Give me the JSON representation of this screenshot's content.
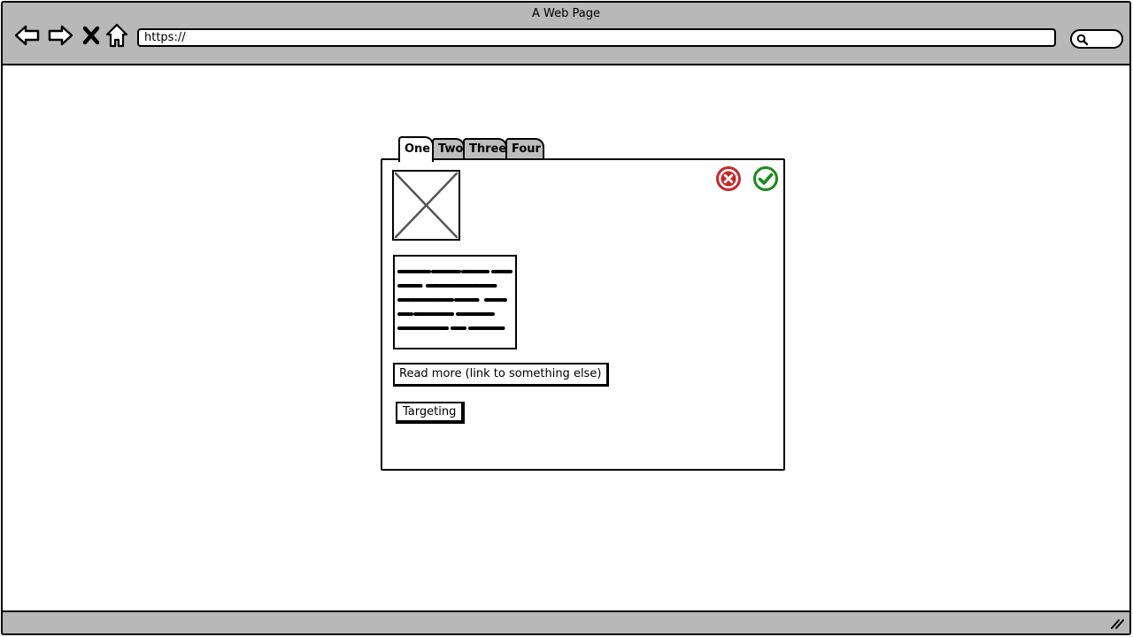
{
  "window": {
    "title": "A Web Page"
  },
  "toolbar": {
    "back_icon": "arrow-left-icon",
    "forward_icon": "arrow-right-icon",
    "stop_icon": "close-icon",
    "home_icon": "home-icon",
    "search_icon": "search-icon"
  },
  "address_bar": {
    "value": "https://"
  },
  "tabs": [
    {
      "label": "One",
      "active": true
    },
    {
      "label": "Two",
      "active": false
    },
    {
      "label": "Three",
      "active": false
    },
    {
      "label": "Four",
      "active": false
    }
  ],
  "panel": {
    "image_placeholder": "image-placeholder-icon",
    "cancel_icon": "cancel-circle-icon",
    "confirm_icon": "check-circle-icon",
    "text_block": "scribbled-text-placeholder",
    "link_label": "Read more (link to something else)",
    "targeting_label": "Targeting"
  },
  "colors": {
    "chrome": "#b8b8b8",
    "cancel": "#c62828",
    "confirm": "#1b8a1b"
  }
}
